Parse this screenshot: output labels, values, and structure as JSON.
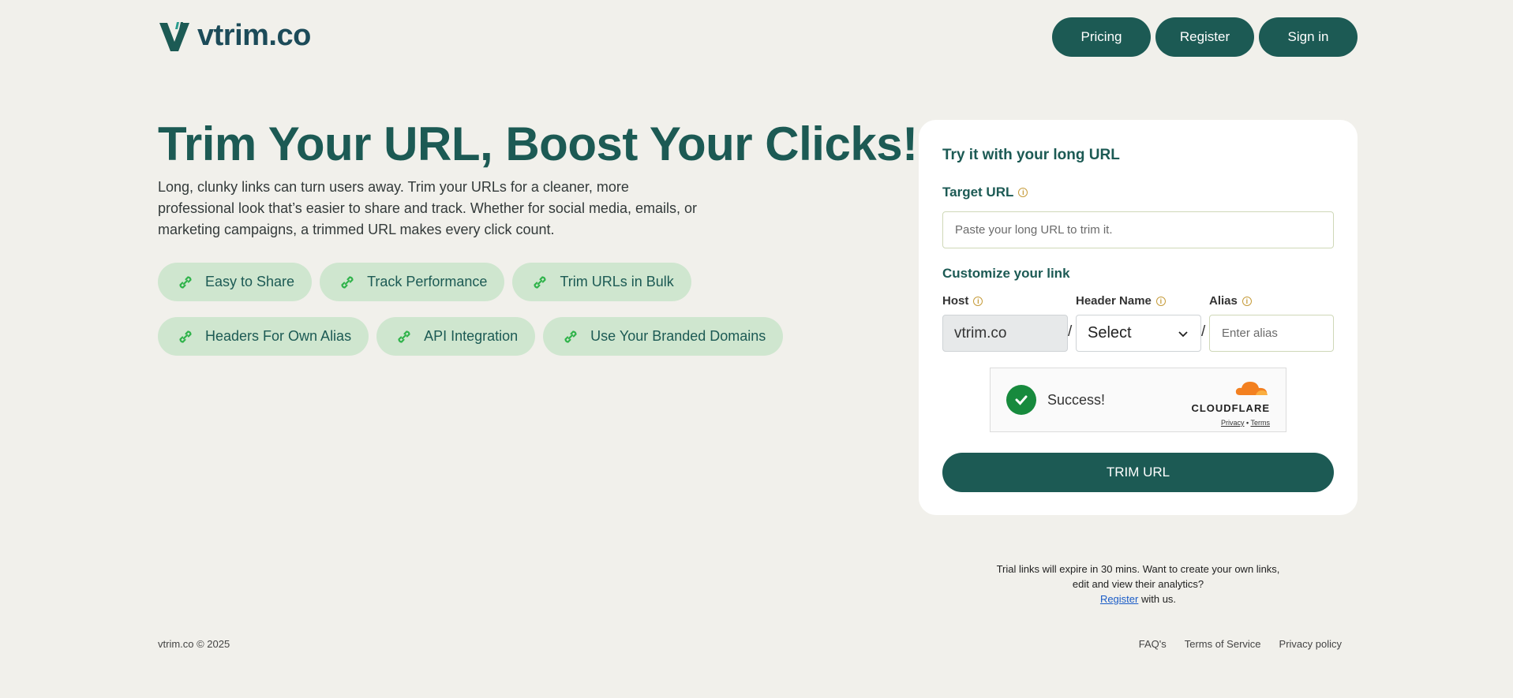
{
  "header": {
    "logo_text": "vtrim.co",
    "nav": {
      "pricing": "Pricing",
      "register": "Register",
      "signin": "Sign in"
    }
  },
  "hero": {
    "title": "Trim Your URL, Boost Your Clicks!",
    "description": "Long, clunky links can turn users away. Trim your URLs for a cleaner, more professional look that’s easier to share and track. Whether for social media, emails, or marketing campaigns, a trimmed URL makes every click count.",
    "features": [
      "Easy to Share",
      "Track Performance",
      "Trim URLs in Bulk",
      "Headers For Own Alias",
      "API Integration",
      "Use Your Branded Domains"
    ]
  },
  "form": {
    "title": "Try it with your long URL",
    "target_label": "Target URL",
    "target_placeholder": "Paste your long URL to trim it.",
    "customize_label": "Customize your link",
    "host_label": "Host",
    "host_value": "vtrim.co",
    "header_name_label": "Header Name",
    "header_name_value": "Select",
    "alias_label": "Alias",
    "alias_placeholder": "Enter alias",
    "separator": "/",
    "captcha_status": "Success!",
    "captcha_brand": "CLOUDFLARE",
    "captcha_privacy": "Privacy",
    "captcha_dot": "•",
    "captcha_terms": "Terms",
    "submit_label": "TRIM URL"
  },
  "trial": {
    "line1": "Trial links will expire in 30 mins. Want to create your own links,",
    "line2": "edit and view their analytics?",
    "register_link": "Register",
    "line3_suffix": " with us."
  },
  "footer": {
    "copyright": "vtrim.co © 2025",
    "links": [
      "FAQ's",
      "Terms of Service",
      "Privacy policy"
    ]
  },
  "colors": {
    "brand": "#1c5a54",
    "background": "#f1f0eb",
    "chip": "#cfe6cf",
    "link_icon": "#2fb34a",
    "info_icon": "#c69c3b",
    "captcha_success": "#178a3d",
    "cloudflare_orange": "#f38020"
  }
}
